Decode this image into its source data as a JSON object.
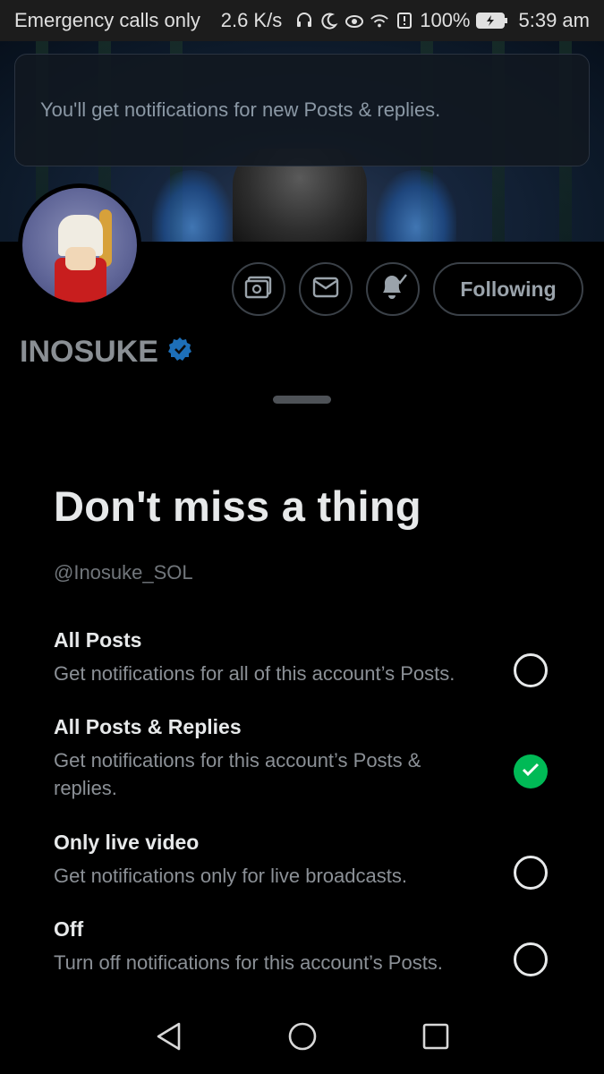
{
  "status_bar": {
    "carrier": "Emergency calls only",
    "speed": "2.6 K/s",
    "battery": "100%",
    "time": "5:39 am"
  },
  "toast": {
    "text": "You'll get notifications for new Posts & replies."
  },
  "profile": {
    "name": "INOSUKE",
    "follow_label": "Following"
  },
  "sheet": {
    "title": "Don't miss a thing",
    "handle": "@Inosuke_SOL",
    "options": [
      {
        "title": "All Posts",
        "desc": "Get notifications for all of this account’s Posts.",
        "selected": false
      },
      {
        "title": "All Posts & Replies",
        "desc": "Get notifications for this account’s Posts & replies.",
        "selected": true
      },
      {
        "title": "Only live video",
        "desc": "Get notifications only for live broadcasts.",
        "selected": false
      },
      {
        "title": "Off",
        "desc": "Turn off notifications for this account’s Posts.",
        "selected": false
      }
    ]
  },
  "colors": {
    "accent_check": "#00ba56",
    "verified": "#1d9bf0"
  }
}
